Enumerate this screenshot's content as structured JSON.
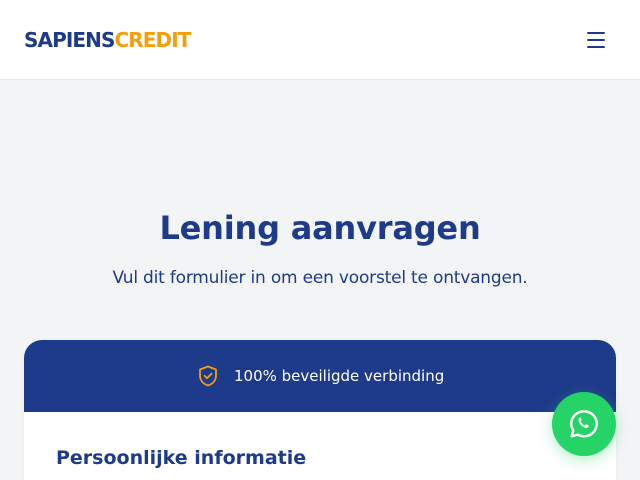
{
  "header": {
    "logo_part1": "SAPIENS",
    "logo_part2": "CREDIT",
    "menu_icon": "hamburger-menu-icon"
  },
  "hero": {
    "title": "Lening aanvragen",
    "subtitle": "Vul dit formulier in om een voorstel te ontvangen."
  },
  "form_card": {
    "secure_label": "100% beveiligde verbinding",
    "secure_icon": "shield-check-icon",
    "section_title": "Persoonlijke informatie"
  },
  "floating": {
    "whatsapp_icon": "whatsapp-icon"
  },
  "colors": {
    "brand_navy": "#1e3a8a",
    "brand_accent": "#f59e0b",
    "whatsapp_green": "#25d366",
    "page_background": "#f3f4f6"
  }
}
